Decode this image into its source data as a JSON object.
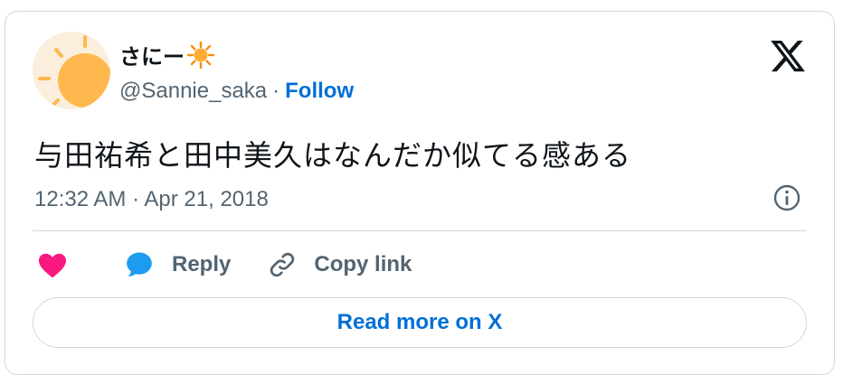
{
  "author": {
    "display_name": "さにー",
    "name_emoji": "sun-emoji",
    "handle": "@Sannie_saka",
    "separator": "·",
    "follow_label": "Follow",
    "avatar_icon": "sun-avatar-icon"
  },
  "tweet": {
    "text": "与田祐希と田中美久はなんだか似てる感ある",
    "timestamp": "12:32 AM · Apr 21, 2018"
  },
  "actions": {
    "like_icon": "heart-icon",
    "reply_icon": "speech-bubble-icon",
    "reply_label": "Reply",
    "copy_icon": "link-icon",
    "copy_label": "Copy link"
  },
  "read_more_label": "Read more on X",
  "colors": {
    "accent": "#006fd6",
    "like": "#f91880",
    "reply": "#1d9bf0",
    "muted": "#536471",
    "sun": "#ffb84d"
  }
}
